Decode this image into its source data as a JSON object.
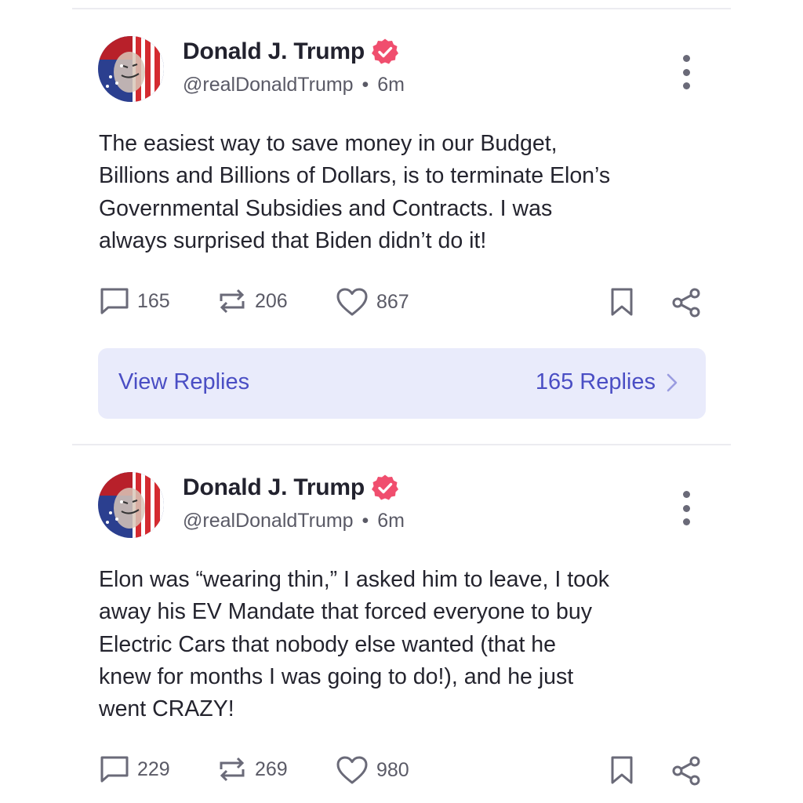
{
  "posts": [
    {
      "author": "Donald J. Trump",
      "handle": "@realDonaldTrump",
      "time": "6m",
      "text_lines": [
        "The easiest way to save money in our Budget,",
        "Billions and Billions of Dollars, is to terminate Elon’s",
        "Governmental Subsidies and Contracts. I was",
        "always surprised that Biden didn’t do it!"
      ],
      "replies": "165",
      "reposts": "206",
      "likes": "867",
      "view_replies_label": "View Replies",
      "replies_count_label": "165 Replies"
    },
    {
      "author": "Donald J. Trump",
      "handle": "@realDonaldTrump",
      "time": "6m",
      "text_lines": [
        "Elon was “wearing thin,” I asked him to leave, I took",
        "away his EV Mandate that forced everyone to buy",
        "Electric Cars that nobody else wanted (that he",
        "knew for months I was going to do!), and he just",
        "went CRAZY!"
      ],
      "replies": "229",
      "reposts": "269",
      "likes": "980"
    }
  ],
  "meta_separator": "•",
  "colors": {
    "verified_badge": "#f04e6e",
    "accent": "#4a4ec4",
    "replies_box_bg": "#e9ebfb",
    "icon_gray": "#6a6a78"
  },
  "icons": {
    "reply": "comment-icon",
    "repost": "repost-icon",
    "like": "heart-icon",
    "bookmark": "bookmark-icon",
    "share": "share-icon",
    "more": "more-vertical-icon",
    "verified": "verified-badge-icon",
    "chevron": "chevron-right-icon"
  }
}
